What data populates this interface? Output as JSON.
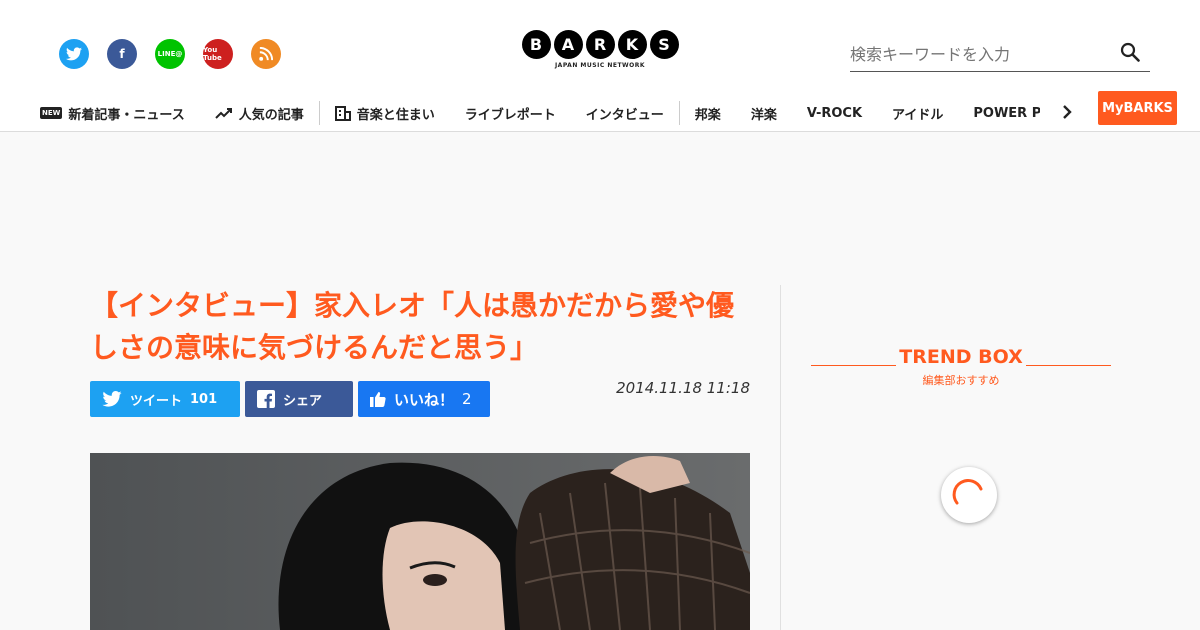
{
  "social": {
    "twitter": "twitter-icon",
    "facebook": "f",
    "line": "LINE@",
    "youtube": "You Tube",
    "rss": "rss-icon"
  },
  "logo": {
    "letters": [
      "B",
      "A",
      "R",
      "K",
      "S"
    ],
    "tagline": "JAPAN MUSIC NETWORK"
  },
  "search": {
    "placeholder": "検索キーワードを入力"
  },
  "nav": {
    "new_badge": "NEW",
    "items": [
      "新着記事・ニュース",
      "人気の記事",
      "音楽と住まい",
      "ライブレポート",
      "インタビュー",
      "邦楽",
      "洋楽",
      "V-ROCK",
      "アイドル",
      "POWER PUSH"
    ]
  },
  "mybarks": "MyBARKS",
  "article": {
    "title": "【インタビュー】家入レオ「人は愚かだから愛や優しさの意味に気づけるんだと思う」",
    "date": "2014.11.18 11:18",
    "share": {
      "tweet_label": "ツイート",
      "tweet_count": "101",
      "fb_label": "シェア",
      "like_label": "いいね！",
      "like_count": "2"
    }
  },
  "trend": {
    "title": "TREND BOX",
    "subtitle": "編集部おすすめ"
  },
  "colors": {
    "accent": "#ff5a1f",
    "twitter": "#1da1f2",
    "facebook": "#3b5998"
  }
}
